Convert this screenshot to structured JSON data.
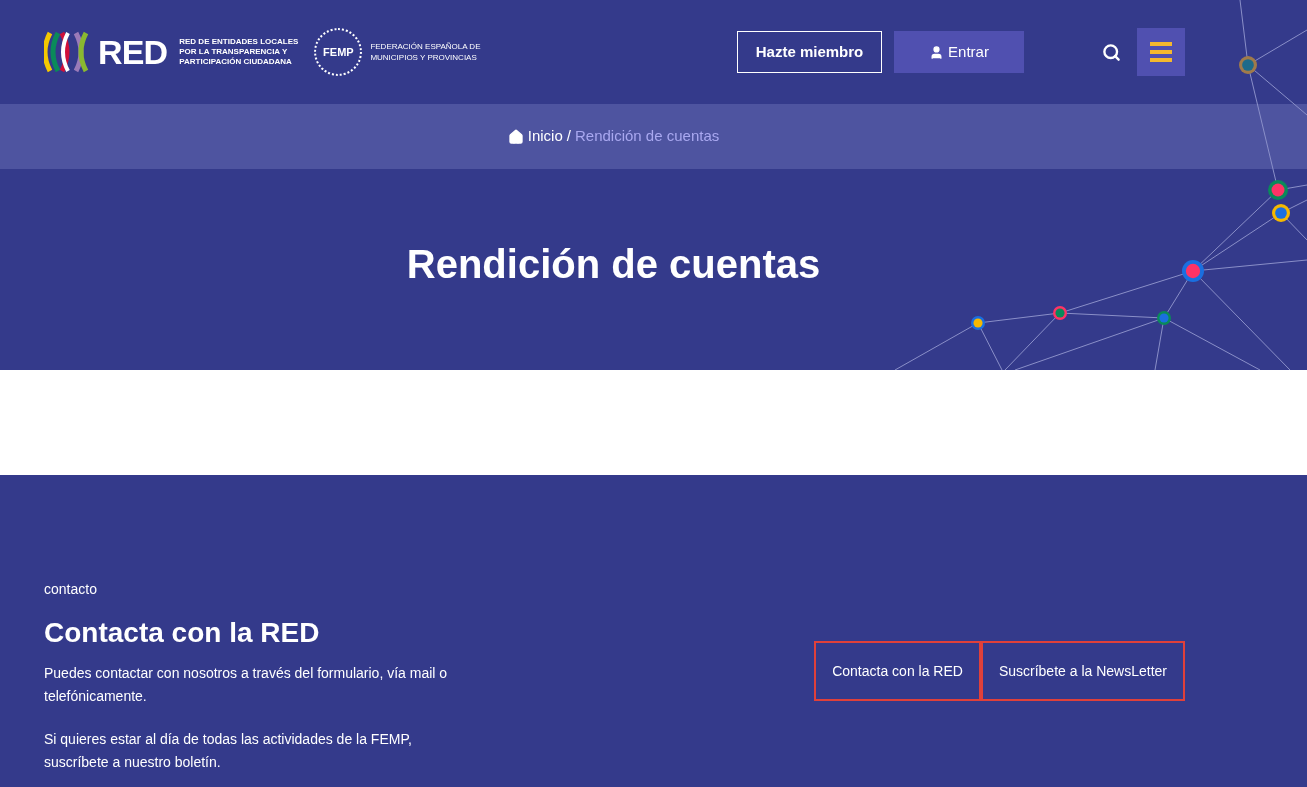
{
  "header": {
    "logo_text": "RED",
    "tagline_lines": [
      "RED DE ENTIDADES LOCALES",
      "POR LA TRANSPARENCIA Y",
      "PARTICIPACIÓN CIUDADANA"
    ],
    "partner_logo_text": "FEMP",
    "partner_lines": [
      "FEDERACIÓN ESPAÑOLA DE",
      "MUNICIPIOS Y PROVINCIAS"
    ],
    "buttons": [
      {
        "label": "Hazte miembro",
        "kind": "outline"
      },
      {
        "label": "Entrar",
        "kind": "user"
      }
    ]
  },
  "breadcrumb": {
    "items": [
      {
        "label": "Inicio",
        "kind": "home",
        "selected": false
      },
      {
        "label": "Rendición de cuentas",
        "kind": "current",
        "selected": true
      }
    ],
    "separator": "/"
  },
  "hero": {
    "title": "Rendición de cuentas"
  },
  "footer": {
    "eyebrow": "contacto",
    "title": "Contacta con la RED",
    "paragraphs": [
      "Puedes contactar con nosotros a través del formulario, vía mail o telefónicamente.",
      "Si quieres estar al día de todas las actividades de la FEMP, suscríbete a nuestro boletín."
    ],
    "buttons": [
      "Contacta con la RED",
      "Suscríbete a la NewsLetter"
    ]
  }
}
